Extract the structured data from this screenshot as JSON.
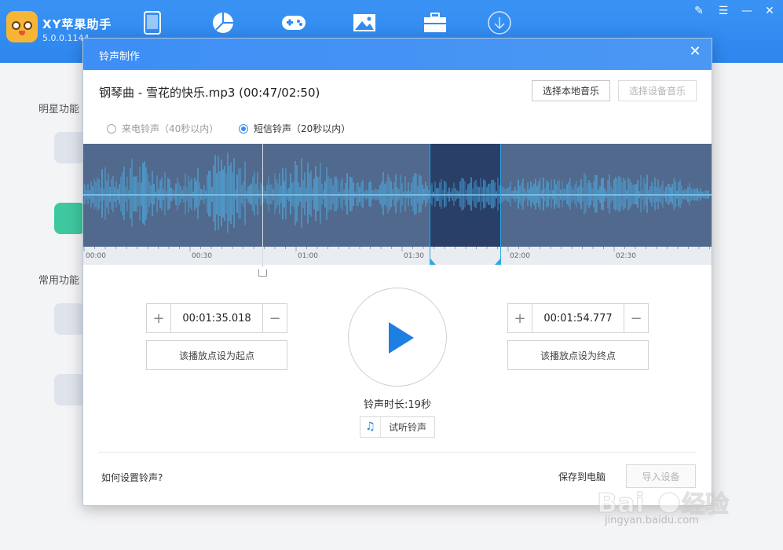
{
  "app": {
    "name": "XY苹果助手",
    "version": "5.0.0.1144",
    "nav_icons": [
      "phone-icon",
      "pie-icon",
      "gamepad-icon",
      "image-icon",
      "toolbox-icon",
      "download-icon"
    ],
    "window_controls": [
      "edit-icon",
      "menu-icon",
      "minimize-icon",
      "close-icon"
    ]
  },
  "sidebar": {
    "section1": "明星功能",
    "section2": "常用功能"
  },
  "dialog": {
    "title": "铃声制作",
    "file_title": "钢琴曲 - 雪花的快乐.mp3 (00:47/02:50)",
    "btn_local": "选择本地音乐",
    "btn_device": "选择设备音乐",
    "radio_call": "来电铃声（40秒以内）",
    "radio_sms": "短信铃声（20秒以内）",
    "radio_selected": "sms",
    "timeline_labels": [
      "00:00",
      "00:30",
      "01:00",
      "01:30",
      "02:00",
      "02:30"
    ],
    "start_time": "00:01:35.018",
    "end_time": "00:01:54.777",
    "set_start": "该播放点设为起点",
    "set_end": "该播放点设为终点",
    "plus": "+",
    "minus": "−",
    "duration": "铃声时长:19秒",
    "preview": "试听铃声",
    "help": "如何设置铃声?",
    "save_pc": "保存到电脑",
    "import": "导入设备"
  },
  "watermark": {
    "text": "jingyan.baidu.com"
  },
  "colors": {
    "accent": "#2f8cf0",
    "play": "#1e7fe3",
    "wave_bg": "#51698c",
    "wave_selection": "#2a3f67",
    "wave_stroke": "#4cc3ff"
  }
}
